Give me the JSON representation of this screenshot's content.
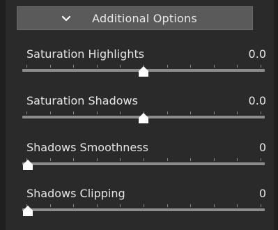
{
  "header": {
    "title": "Additional Options",
    "icon": "chevron-down-icon"
  },
  "sliders": [
    {
      "label": "Saturation Highlights",
      "value_text": "0.0",
      "position": 0.5
    },
    {
      "label": "Saturation Shadows",
      "value_text": "0.0",
      "position": 0.5
    },
    {
      "label": "Shadows Smoothness",
      "value_text": "0",
      "position": 0.0
    },
    {
      "label": "Shadows Clipping",
      "value_text": "0",
      "position": 0.0
    }
  ],
  "colors": {
    "panel_bg": "#2a2a2a",
    "header_bg": "#5a5a5a",
    "track": "#8c8c8c",
    "thumb": "#ffffff",
    "text": "#e6e6e6"
  }
}
